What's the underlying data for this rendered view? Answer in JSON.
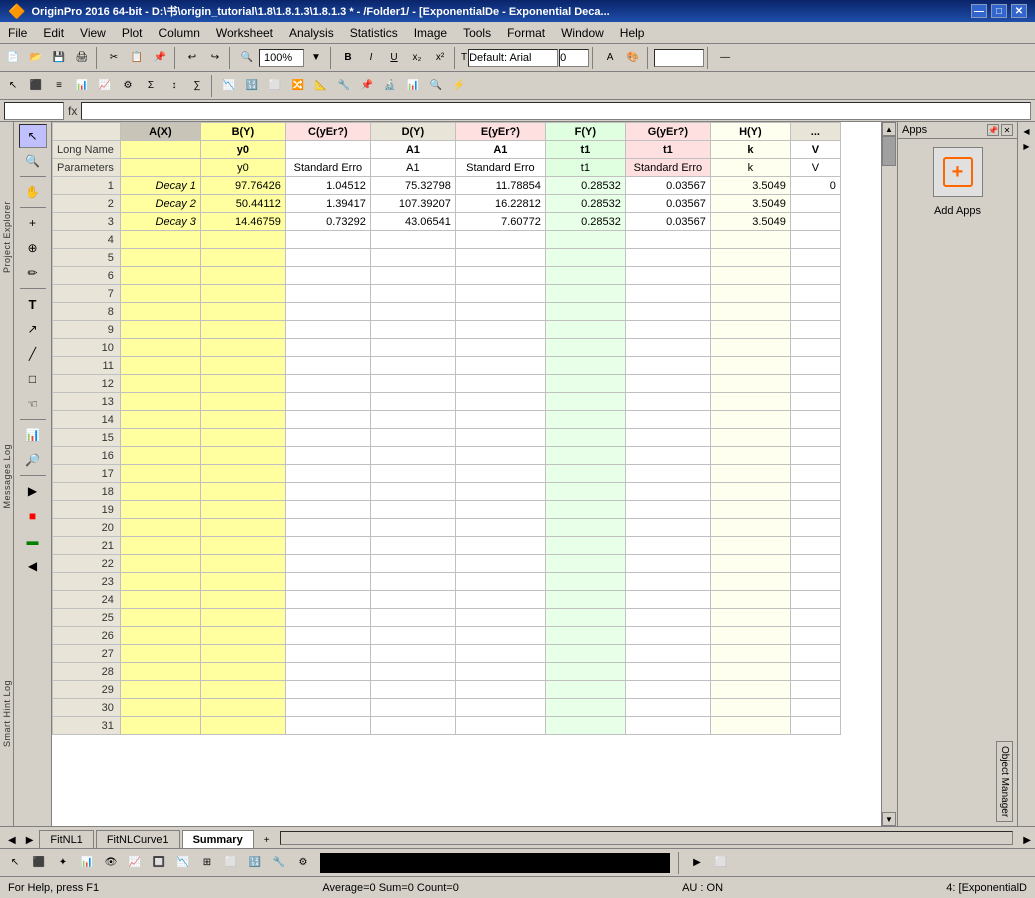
{
  "titlebar": {
    "title": "OriginPro 2016 64-bit - D:\\书\\origin_tutorial\\1.8\\1.8.1.3\\1.8.1.3 * - /Folder1/ - [ExponentialDe - Exponential Deca...",
    "app_name": "OriginPro 2016 64-bit",
    "minimize": "—",
    "maximize": "□",
    "close": "✕"
  },
  "menubar": {
    "items": [
      "File",
      "Edit",
      "View",
      "Plot",
      "Column",
      "Worksheet",
      "Analysis",
      "Statistics",
      "Image",
      "Tools",
      "Format",
      "Window",
      "Help"
    ]
  },
  "toolbar1": {
    "zoom": "100%"
  },
  "formula_bar": {
    "cell_ref": "",
    "formula": ""
  },
  "spreadsheet": {
    "columns": [
      {
        "id": "A",
        "label": "A(X)",
        "long_name": "",
        "params": "",
        "bg": ""
      },
      {
        "id": "B",
        "label": "B(Y)",
        "long_name": "y0",
        "params": "y0",
        "bg": "yellow"
      },
      {
        "id": "C",
        "label": "C(yEr?)",
        "long_name": "",
        "params": "Standard Error",
        "bg": ""
      },
      {
        "id": "D",
        "label": "D(Y)",
        "long_name": "A1",
        "params": "A1",
        "bg": ""
      },
      {
        "id": "E",
        "label": "E(yEr?)",
        "long_name": "A1",
        "params": "Standard Error",
        "bg": ""
      },
      {
        "id": "F",
        "label": "F(Y)",
        "long_name": "t1",
        "params": "t1",
        "bg": ""
      },
      {
        "id": "G",
        "label": "G(yEr?)",
        "long_name": "t1",
        "params": "Standard Error",
        "bg": ""
      },
      {
        "id": "H",
        "label": "H(Y)",
        "long_name": "k",
        "params": "k",
        "bg": ""
      },
      {
        "id": "I",
        "label": "...",
        "long_name": "V",
        "params": "V",
        "bg": ""
      }
    ],
    "rows": [
      {
        "row_num": "1",
        "label": "Decay 1",
        "B": "97.76426",
        "C": "1.04512",
        "D": "75.32798",
        "E": "11.78854",
        "F": "0.28532",
        "G": "0.03567",
        "H": "3.5049",
        "I": "0"
      },
      {
        "row_num": "2",
        "label": "Decay 2",
        "B": "50.44112",
        "C": "1.39417",
        "D": "107.39207",
        "E": "16.22812",
        "F": "0.28532",
        "G": "0.03567",
        "H": "3.5049",
        "I": ""
      },
      {
        "row_num": "3",
        "label": "Decay 3",
        "B": "14.46759",
        "C": "0.73292",
        "D": "43.06541",
        "E": "7.60772",
        "F": "0.28532",
        "G": "0.03567",
        "H": "3.5049",
        "I": ""
      },
      {
        "row_num": "4",
        "label": "",
        "B": "",
        "C": "",
        "D": "",
        "E": "",
        "F": "",
        "G": "",
        "H": "",
        "I": ""
      },
      {
        "row_num": "5",
        "label": "",
        "B": "",
        "C": "",
        "D": "",
        "E": "",
        "F": "",
        "G": "",
        "H": "",
        "I": ""
      },
      {
        "row_num": "6",
        "label": "",
        "B": "",
        "C": "",
        "D": "",
        "E": "",
        "F": "",
        "G": "",
        "H": "",
        "I": ""
      },
      {
        "row_num": "7",
        "label": "",
        "B": "",
        "C": "",
        "D": "",
        "E": "",
        "F": "",
        "G": "",
        "H": "",
        "I": ""
      },
      {
        "row_num": "8",
        "label": "",
        "B": "",
        "C": "",
        "D": "",
        "E": "",
        "F": "",
        "G": "",
        "H": "",
        "I": ""
      },
      {
        "row_num": "9",
        "label": "",
        "B": "",
        "C": "",
        "D": "",
        "E": "",
        "F": "",
        "G": "",
        "H": "",
        "I": ""
      },
      {
        "row_num": "10",
        "label": "",
        "B": "",
        "C": "",
        "D": "",
        "E": "",
        "F": "",
        "G": "",
        "H": "",
        "I": ""
      },
      {
        "row_num": "11",
        "label": "",
        "B": "",
        "C": "",
        "D": "",
        "E": "",
        "F": "",
        "G": "",
        "H": "",
        "I": ""
      },
      {
        "row_num": "12",
        "label": "",
        "B": "",
        "C": "",
        "D": "",
        "E": "",
        "F": "",
        "G": "",
        "H": "",
        "I": ""
      },
      {
        "row_num": "13",
        "label": "",
        "B": "",
        "C": "",
        "D": "",
        "E": "",
        "F": "",
        "G": "",
        "H": "",
        "I": ""
      },
      {
        "row_num": "14",
        "label": "",
        "B": "",
        "C": "",
        "D": "",
        "E": "",
        "F": "",
        "G": "",
        "H": "",
        "I": ""
      },
      {
        "row_num": "15",
        "label": "",
        "B": "",
        "C": "",
        "D": "",
        "E": "",
        "F": "",
        "G": "",
        "H": "",
        "I": ""
      },
      {
        "row_num": "16",
        "label": "",
        "B": "",
        "C": "",
        "D": "",
        "E": "",
        "F": "",
        "G": "",
        "H": "",
        "I": ""
      },
      {
        "row_num": "17",
        "label": "",
        "B": "",
        "C": "",
        "D": "",
        "E": "",
        "F": "",
        "G": "",
        "H": "",
        "I": ""
      },
      {
        "row_num": "18",
        "label": "",
        "B": "",
        "C": "",
        "D": "",
        "E": "",
        "F": "",
        "G": "",
        "H": "",
        "I": ""
      },
      {
        "row_num": "19",
        "label": "",
        "B": "",
        "C": "",
        "D": "",
        "E": "",
        "F": "",
        "G": "",
        "H": "",
        "I": ""
      },
      {
        "row_num": "20",
        "label": "",
        "B": "",
        "C": "",
        "D": "",
        "E": "",
        "F": "",
        "G": "",
        "H": "",
        "I": ""
      },
      {
        "row_num": "21",
        "label": "",
        "B": "",
        "C": "",
        "D": "",
        "E": "",
        "F": "",
        "G": "",
        "H": "",
        "I": ""
      },
      {
        "row_num": "22",
        "label": "",
        "B": "",
        "C": "",
        "D": "",
        "E": "",
        "F": "",
        "G": "",
        "H": "",
        "I": ""
      },
      {
        "row_num": "23",
        "label": "",
        "B": "",
        "C": "",
        "D": "",
        "E": "",
        "F": "",
        "G": "",
        "H": "",
        "I": ""
      },
      {
        "row_num": "24",
        "label": "",
        "B": "",
        "C": "",
        "D": "",
        "E": "",
        "F": "",
        "G": "",
        "H": "",
        "I": ""
      },
      {
        "row_num": "25",
        "label": "",
        "B": "",
        "C": "",
        "D": "",
        "E": "",
        "F": "",
        "G": "",
        "H": "",
        "I": ""
      },
      {
        "row_num": "26",
        "label": "",
        "B": "",
        "C": "",
        "D": "",
        "E": "",
        "F": "",
        "G": "",
        "H": "",
        "I": ""
      },
      {
        "row_num": "27",
        "label": "",
        "B": "",
        "C": "",
        "D": "",
        "E": "",
        "F": "",
        "G": "",
        "H": "",
        "I": ""
      },
      {
        "row_num": "28",
        "label": "",
        "B": "",
        "C": "",
        "D": "",
        "E": "",
        "F": "",
        "G": "",
        "H": "",
        "I": ""
      },
      {
        "row_num": "29",
        "label": "",
        "B": "",
        "C": "",
        "D": "",
        "E": "",
        "F": "",
        "G": "",
        "H": "",
        "I": ""
      },
      {
        "row_num": "30",
        "label": "",
        "B": "",
        "C": "",
        "D": "",
        "E": "",
        "F": "",
        "G": "",
        "H": "",
        "I": ""
      },
      {
        "row_num": "31",
        "label": "",
        "B": "",
        "C": "",
        "D": "",
        "E": "",
        "F": "",
        "G": "",
        "H": "",
        "I": ""
      }
    ]
  },
  "sheet_tabs": {
    "tabs": [
      "FitNL1",
      "FitNLCurve1",
      "Summary"
    ],
    "active": "Summary"
  },
  "statusbar": {
    "help_text": "For Help, press F1",
    "stats": "Average=0  Sum=0  Count=0",
    "au": "AU : ON",
    "window": "4: [ExponentialD"
  },
  "apps_panel": {
    "title": "Apps",
    "add_apps": "Add Apps"
  },
  "left_labels": {
    "project_explorer": "Project Explorer",
    "messages_log": "Messages Log",
    "smart_hint_log": "Smart Hint Log"
  },
  "font": {
    "name": "Default: Arial",
    "size": "0"
  }
}
